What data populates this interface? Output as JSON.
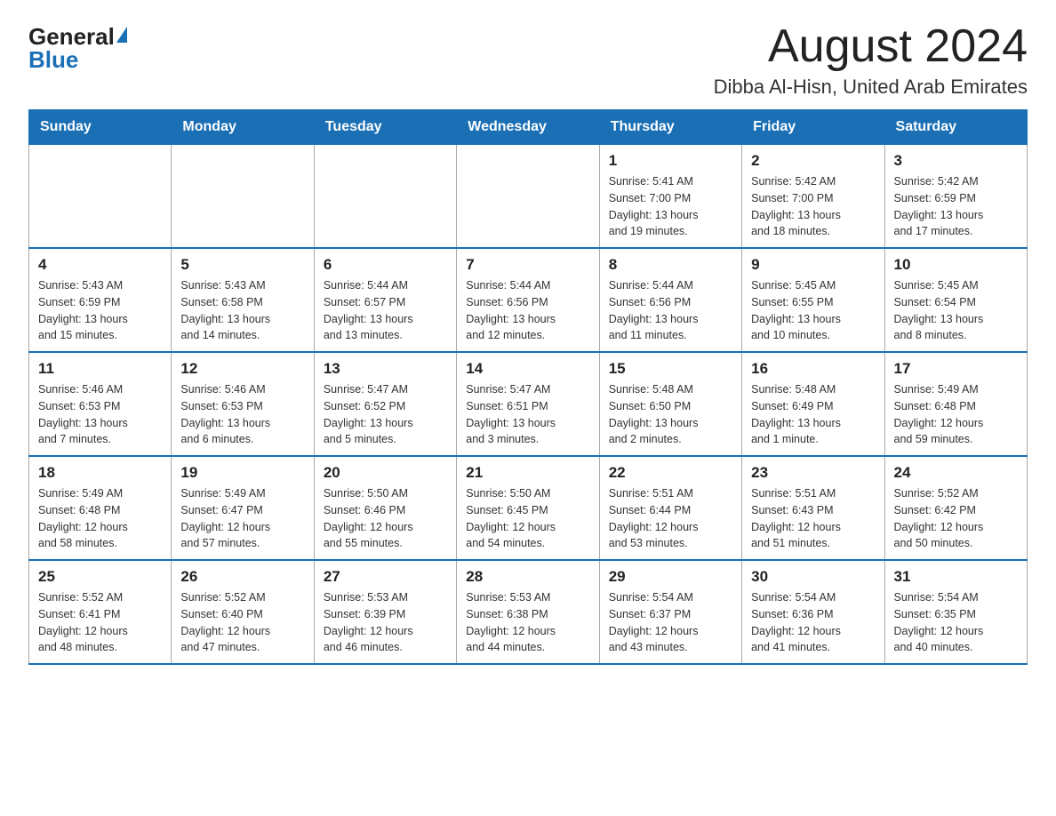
{
  "logo": {
    "general": "General",
    "blue": "Blue"
  },
  "title": "August 2024",
  "location": "Dibba Al-Hisn, United Arab Emirates",
  "days_of_week": [
    "Sunday",
    "Monday",
    "Tuesday",
    "Wednesday",
    "Thursday",
    "Friday",
    "Saturday"
  ],
  "weeks": [
    [
      {
        "day": "",
        "info": ""
      },
      {
        "day": "",
        "info": ""
      },
      {
        "day": "",
        "info": ""
      },
      {
        "day": "",
        "info": ""
      },
      {
        "day": "1",
        "info": "Sunrise: 5:41 AM\nSunset: 7:00 PM\nDaylight: 13 hours\nand 19 minutes."
      },
      {
        "day": "2",
        "info": "Sunrise: 5:42 AM\nSunset: 7:00 PM\nDaylight: 13 hours\nand 18 minutes."
      },
      {
        "day": "3",
        "info": "Sunrise: 5:42 AM\nSunset: 6:59 PM\nDaylight: 13 hours\nand 17 minutes."
      }
    ],
    [
      {
        "day": "4",
        "info": "Sunrise: 5:43 AM\nSunset: 6:59 PM\nDaylight: 13 hours\nand 15 minutes."
      },
      {
        "day": "5",
        "info": "Sunrise: 5:43 AM\nSunset: 6:58 PM\nDaylight: 13 hours\nand 14 minutes."
      },
      {
        "day": "6",
        "info": "Sunrise: 5:44 AM\nSunset: 6:57 PM\nDaylight: 13 hours\nand 13 minutes."
      },
      {
        "day": "7",
        "info": "Sunrise: 5:44 AM\nSunset: 6:56 PM\nDaylight: 13 hours\nand 12 minutes."
      },
      {
        "day": "8",
        "info": "Sunrise: 5:44 AM\nSunset: 6:56 PM\nDaylight: 13 hours\nand 11 minutes."
      },
      {
        "day": "9",
        "info": "Sunrise: 5:45 AM\nSunset: 6:55 PM\nDaylight: 13 hours\nand 10 minutes."
      },
      {
        "day": "10",
        "info": "Sunrise: 5:45 AM\nSunset: 6:54 PM\nDaylight: 13 hours\nand 8 minutes."
      }
    ],
    [
      {
        "day": "11",
        "info": "Sunrise: 5:46 AM\nSunset: 6:53 PM\nDaylight: 13 hours\nand 7 minutes."
      },
      {
        "day": "12",
        "info": "Sunrise: 5:46 AM\nSunset: 6:53 PM\nDaylight: 13 hours\nand 6 minutes."
      },
      {
        "day": "13",
        "info": "Sunrise: 5:47 AM\nSunset: 6:52 PM\nDaylight: 13 hours\nand 5 minutes."
      },
      {
        "day": "14",
        "info": "Sunrise: 5:47 AM\nSunset: 6:51 PM\nDaylight: 13 hours\nand 3 minutes."
      },
      {
        "day": "15",
        "info": "Sunrise: 5:48 AM\nSunset: 6:50 PM\nDaylight: 13 hours\nand 2 minutes."
      },
      {
        "day": "16",
        "info": "Sunrise: 5:48 AM\nSunset: 6:49 PM\nDaylight: 13 hours\nand 1 minute."
      },
      {
        "day": "17",
        "info": "Sunrise: 5:49 AM\nSunset: 6:48 PM\nDaylight: 12 hours\nand 59 minutes."
      }
    ],
    [
      {
        "day": "18",
        "info": "Sunrise: 5:49 AM\nSunset: 6:48 PM\nDaylight: 12 hours\nand 58 minutes."
      },
      {
        "day": "19",
        "info": "Sunrise: 5:49 AM\nSunset: 6:47 PM\nDaylight: 12 hours\nand 57 minutes."
      },
      {
        "day": "20",
        "info": "Sunrise: 5:50 AM\nSunset: 6:46 PM\nDaylight: 12 hours\nand 55 minutes."
      },
      {
        "day": "21",
        "info": "Sunrise: 5:50 AM\nSunset: 6:45 PM\nDaylight: 12 hours\nand 54 minutes."
      },
      {
        "day": "22",
        "info": "Sunrise: 5:51 AM\nSunset: 6:44 PM\nDaylight: 12 hours\nand 53 minutes."
      },
      {
        "day": "23",
        "info": "Sunrise: 5:51 AM\nSunset: 6:43 PM\nDaylight: 12 hours\nand 51 minutes."
      },
      {
        "day": "24",
        "info": "Sunrise: 5:52 AM\nSunset: 6:42 PM\nDaylight: 12 hours\nand 50 minutes."
      }
    ],
    [
      {
        "day": "25",
        "info": "Sunrise: 5:52 AM\nSunset: 6:41 PM\nDaylight: 12 hours\nand 48 minutes."
      },
      {
        "day": "26",
        "info": "Sunrise: 5:52 AM\nSunset: 6:40 PM\nDaylight: 12 hours\nand 47 minutes."
      },
      {
        "day": "27",
        "info": "Sunrise: 5:53 AM\nSunset: 6:39 PM\nDaylight: 12 hours\nand 46 minutes."
      },
      {
        "day": "28",
        "info": "Sunrise: 5:53 AM\nSunset: 6:38 PM\nDaylight: 12 hours\nand 44 minutes."
      },
      {
        "day": "29",
        "info": "Sunrise: 5:54 AM\nSunset: 6:37 PM\nDaylight: 12 hours\nand 43 minutes."
      },
      {
        "day": "30",
        "info": "Sunrise: 5:54 AM\nSunset: 6:36 PM\nDaylight: 12 hours\nand 41 minutes."
      },
      {
        "day": "31",
        "info": "Sunrise: 5:54 AM\nSunset: 6:35 PM\nDaylight: 12 hours\nand 40 minutes."
      }
    ]
  ]
}
